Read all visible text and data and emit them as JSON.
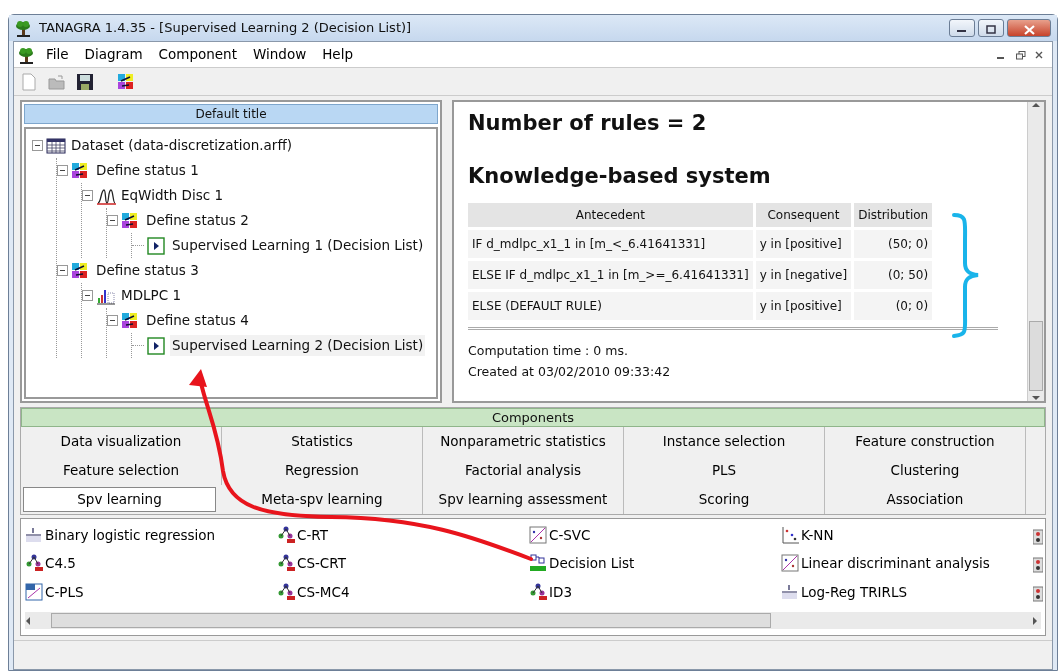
{
  "window": {
    "title": "TANAGRA 1.4.35 - [Supervised Learning 2 (Decision List)]"
  },
  "menu": [
    "File",
    "Diagram",
    "Component",
    "Window",
    "Help"
  ],
  "diagram": {
    "title": "Default title",
    "tree": [
      {
        "label": "Dataset (data-discretization.arff)",
        "kind": "dataset",
        "expanded": true,
        "selected": false,
        "children": [
          {
            "label": "Define status 1",
            "kind": "status",
            "expanded": true,
            "selected": false,
            "children": [
              {
                "label": "EqWidth Disc 1",
                "kind": "disc",
                "expanded": true,
                "selected": false,
                "children": [
                  {
                    "label": "Define status 2",
                    "kind": "status",
                    "expanded": true,
                    "selected": false,
                    "children": [
                      {
                        "label": "Supervised Learning 1 (Decision List)",
                        "kind": "learner",
                        "selected": false
                      }
                    ]
                  }
                ]
              }
            ]
          },
          {
            "label": "Define status 3",
            "kind": "status",
            "expanded": true,
            "selected": false,
            "children": [
              {
                "label": "MDLPC 1",
                "kind": "mdlpc",
                "expanded": true,
                "selected": false,
                "children": [
                  {
                    "label": "Define status 4",
                    "kind": "status",
                    "expanded": true,
                    "selected": false,
                    "children": [
                      {
                        "label": "Supervised Learning 2 (Decision List)",
                        "kind": "learner",
                        "selected": true
                      }
                    ]
                  }
                ]
              }
            ]
          }
        ]
      }
    ]
  },
  "result": {
    "heading": "Number of rules = 2",
    "subheading": "Knowledge-based system",
    "table": {
      "columns": [
        "Antecedent",
        "Consequent",
        "Distribution"
      ],
      "rows": [
        [
          "IF d_mdlpc_x1_1 in [m_<_6.41641331]",
          "y in [positive]",
          "(50; 0)"
        ],
        [
          "ELSE IF d_mdlpc_x1_1 in [m_>=_6.41641331]",
          "y in [negative]",
          "(0; 50)"
        ],
        [
          "ELSE (DEFAULT RULE)",
          "y in [positive]",
          "(0; 0)"
        ]
      ]
    },
    "computation": "Computation time : 0 ms.",
    "created": "Created at 03/02/2010 09:33:42"
  },
  "components": {
    "title": "Components",
    "tabs": [
      {
        "label": "Data visualization",
        "selected": false
      },
      {
        "label": "Statistics",
        "selected": false
      },
      {
        "label": "Nonparametric statistics",
        "selected": false
      },
      {
        "label": "Instance selection",
        "selected": false
      },
      {
        "label": "Feature construction",
        "selected": false
      },
      {
        "label": "Feature selection",
        "selected": false
      },
      {
        "label": "Regression",
        "selected": false
      },
      {
        "label": "Factorial analysis",
        "selected": false
      },
      {
        "label": "PLS",
        "selected": false
      },
      {
        "label": "Clustering",
        "selected": false
      },
      {
        "label": "Spv learning",
        "selected": true
      },
      {
        "label": "Meta-spv learning",
        "selected": false
      },
      {
        "label": "Spv learning assessment",
        "selected": false
      },
      {
        "label": "Scoring",
        "selected": false
      },
      {
        "label": "Association",
        "selected": false
      }
    ],
    "items": [
      {
        "label": "Binary logistic regression",
        "kind": "logit"
      },
      {
        "label": "C-RT",
        "kind": "tree"
      },
      {
        "label": "C-SVC",
        "kind": "svm"
      },
      {
        "label": "K-NN",
        "kind": "knn"
      },
      {
        "label": "C4.5",
        "kind": "tree"
      },
      {
        "label": "CS-CRT",
        "kind": "tree"
      },
      {
        "label": "Decision List",
        "kind": "rules"
      },
      {
        "label": "Linear discriminant analysis",
        "kind": "svm"
      },
      {
        "label": "C-PLS",
        "kind": "pls"
      },
      {
        "label": "CS-MC4",
        "kind": "tree"
      },
      {
        "label": "ID3",
        "kind": "tree"
      },
      {
        "label": "Log-Reg TRIRLS",
        "kind": "logit"
      }
    ]
  }
}
